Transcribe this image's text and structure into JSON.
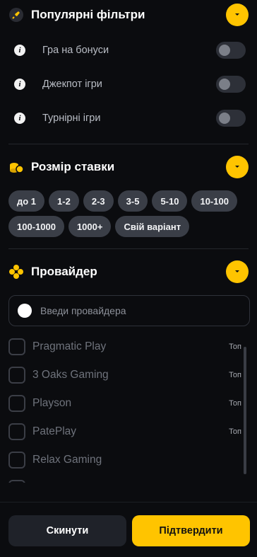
{
  "popular": {
    "title": "Популярні фільтри",
    "icon": "rocket-icon",
    "toggles": [
      {
        "label": "Гра на бонуси",
        "on": false
      },
      {
        "label": "Джекпот ігри",
        "on": false
      },
      {
        "label": "Турнірні ігри",
        "on": false
      }
    ]
  },
  "bet_size": {
    "title": "Розмір ставки",
    "icon": "coins-icon",
    "chips_row1": [
      "до 1",
      "1-2",
      "2-3",
      "3-5",
      "5-10",
      "10-100"
    ],
    "chips_row2": [
      "100-1000",
      "1000+",
      "Свій варіант"
    ]
  },
  "provider": {
    "title": "Провайдер",
    "icon": "clover-icon",
    "search_placeholder": "Введи провайдера",
    "items": [
      {
        "name": "Pragmatic Play",
        "tag": "Топ"
      },
      {
        "name": "3 Oaks Gaming",
        "tag": "Топ"
      },
      {
        "name": "Playson",
        "tag": "Топ"
      },
      {
        "name": "PatePlay",
        "tag": "Топ"
      },
      {
        "name": "Relax Gaming",
        "tag": ""
      }
    ]
  },
  "footer": {
    "reset_label": "Скинути",
    "confirm_label": "Підтвердити"
  },
  "colors": {
    "accent": "#ffc400",
    "background": "#0b0c0f",
    "chip": "#3a3e47"
  }
}
